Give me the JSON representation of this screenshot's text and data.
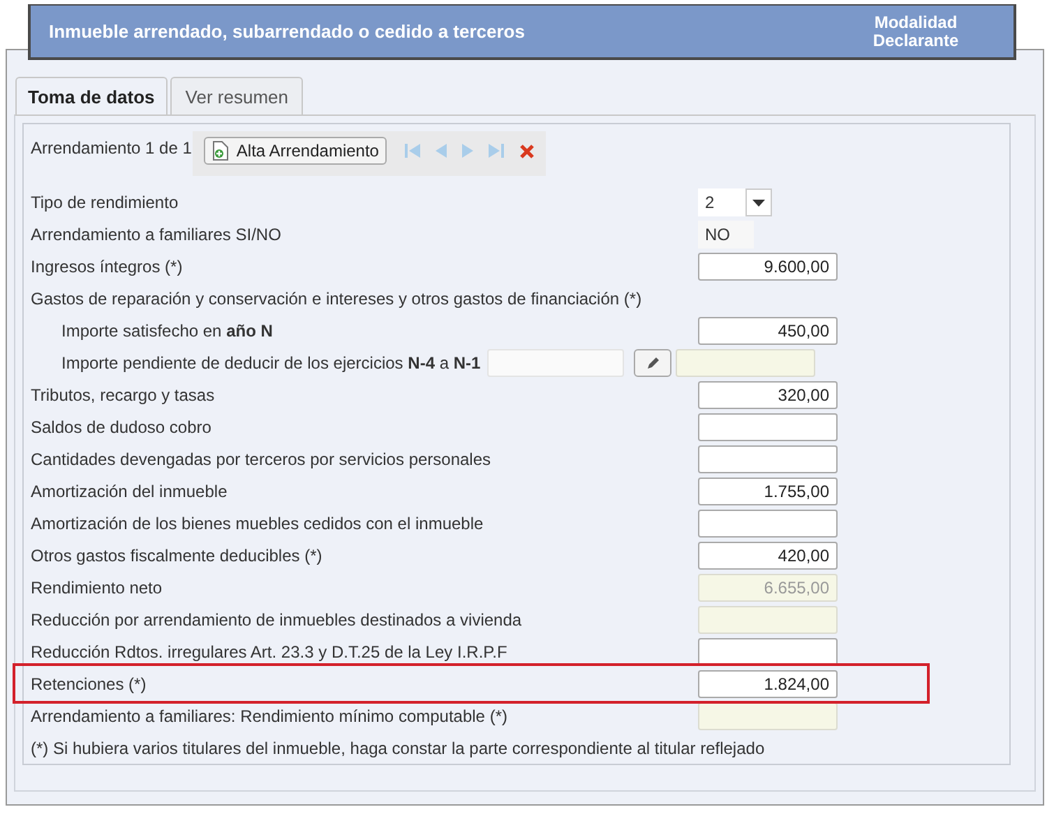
{
  "header": {
    "title": "Inmueble arrendado, subarrendado o cedido a terceros",
    "mode": "Modalidad Declarante"
  },
  "tabs": [
    {
      "label": "Toma de datos",
      "selected": true
    },
    {
      "label": "Ver resumen",
      "selected": false
    }
  ],
  "record": {
    "counter": "Arrendamiento 1 de 1",
    "add_button": "Alta Arrendamiento"
  },
  "rows": [
    {
      "kind": "select",
      "label": "Tipo de rendimiento",
      "value": "2"
    },
    {
      "kind": "display",
      "label": "Arrendamiento a familiares SI/NO",
      "value": "NO"
    },
    {
      "kind": "field",
      "label": "Ingresos íntegros (*)",
      "value": "9.600,00",
      "readonly": false,
      "highlighted": false
    },
    {
      "kind": "heading",
      "label": "Gastos de reparación y conservación e intereses y otros gastos de financiación (*)"
    },
    {
      "kind": "subfield",
      "label": "Importe satisfecho en **año N**",
      "value": "450,00",
      "readonly": false
    },
    {
      "kind": "pending",
      "label": "Importe pendiente de deducir de los ejercicios **N-4** a **N-1**",
      "readonly": true
    },
    {
      "kind": "field",
      "label": "Tributos, recargo y tasas",
      "value": "320,00",
      "readonly": false,
      "highlighted": false
    },
    {
      "kind": "field",
      "label": "Saldos de dudoso cobro",
      "readonly": false,
      "highlighted": false
    },
    {
      "kind": "field",
      "label": "Cantidades devengadas por terceros por servicios personales",
      "readonly": false,
      "highlighted": false
    },
    {
      "kind": "field",
      "label": "Amortización del inmueble",
      "value": "1.755,00",
      "readonly": false,
      "highlighted": false
    },
    {
      "kind": "field",
      "label": "Amortización de los bienes muebles cedidos con el inmueble",
      "readonly": false,
      "highlighted": false
    },
    {
      "kind": "field",
      "label": "Otros gastos fiscalmente deducibles (*)",
      "value": "420,00",
      "readonly": false,
      "highlighted": false
    },
    {
      "kind": "field",
      "label": "Rendimiento neto",
      "value": "6.655,00",
      "readonly": true,
      "highlighted": false
    },
    {
      "kind": "field",
      "label": "Reducción por arrendamiento de inmuebles destinados a vivienda",
      "readonly": true,
      "highlighted": false
    },
    {
      "kind": "field",
      "label": "Reducción Rdtos. irregulares Art. 23.3 y D.T.25 de la Ley I.R.P.F",
      "readonly": false,
      "highlighted": false
    },
    {
      "kind": "field",
      "label": "Retenciones (*)",
      "value": "1.824,00",
      "readonly": false,
      "highlighted": true
    },
    {
      "kind": "field",
      "label": "Arrendamiento a familiares: Rendimiento mínimo computable (*)",
      "readonly": true,
      "highlighted": false
    }
  ],
  "footnote": "(*) Si hubiera varios titulares del inmueble, haga constar la parte correspondiente al titular reflejado"
}
